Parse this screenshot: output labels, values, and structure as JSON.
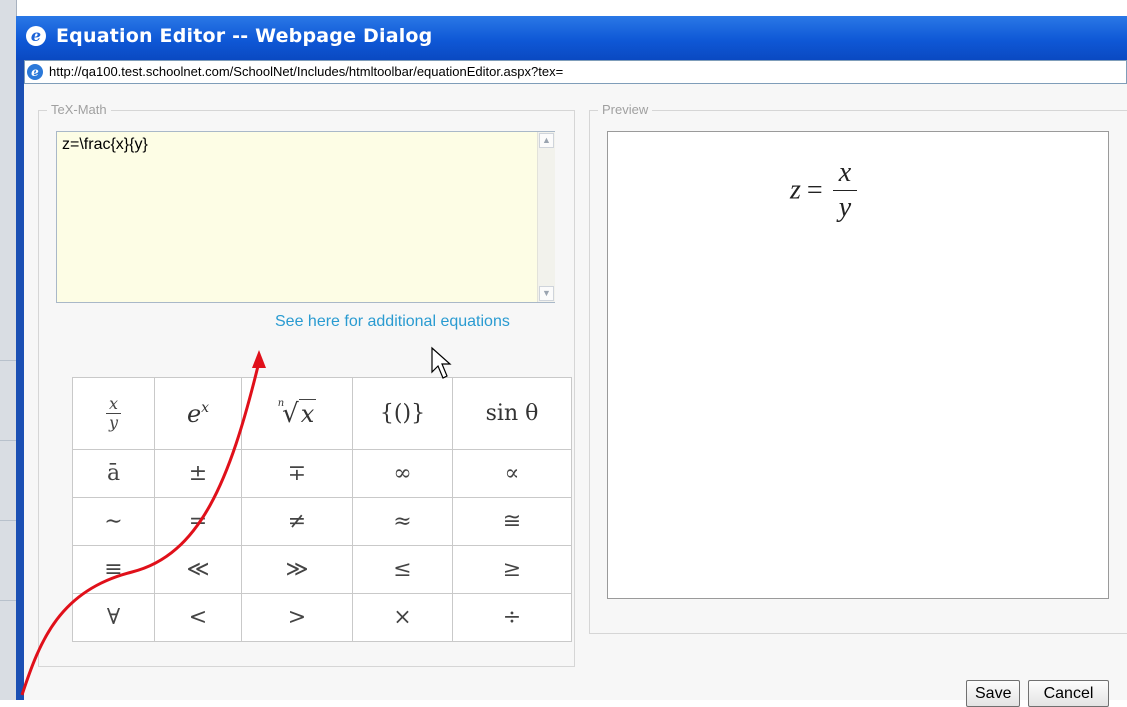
{
  "dialog": {
    "title": "Equation Editor -- Webpage Dialog",
    "title_icon": "ie-icon",
    "url": "http://qa100.test.schoolnet.com/SchoolNet/Includes/htmltoolbar/equationEditor.aspx?tex="
  },
  "tex_panel": {
    "legend": "TeX-Math",
    "input_value": "z=\\frac{x}{y}",
    "more_link": "See here for additional equations"
  },
  "symbols": {
    "row1": {
      "s2": "{()}",
      "s4": "sin θ"
    },
    "rows": [
      [
        "ā",
        "±",
        "∓",
        "∞",
        "∝"
      ],
      [
        "∼",
        "=",
        "≠",
        "≈",
        "≅"
      ],
      [
        "≡",
        "≪",
        "≫",
        "≤",
        "≥"
      ],
      [
        "∀",
        "<",
        ">",
        "×",
        "÷"
      ]
    ]
  },
  "preview_panel": {
    "legend": "Preview"
  },
  "buttons": {
    "save": "Save",
    "cancel": "Cancel"
  },
  "colors": {
    "titlebar": "#0f58d6",
    "link": "#2a9bd1",
    "input_bg": "#fdfde5",
    "annotation_arrow": "#e0101a"
  }
}
